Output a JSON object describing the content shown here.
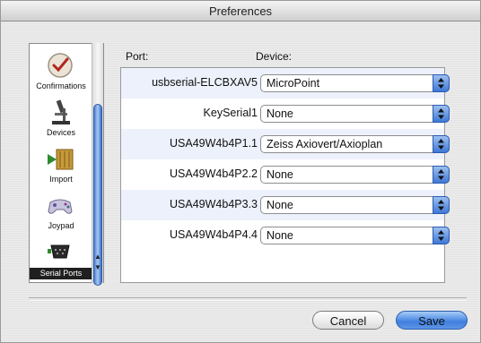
{
  "window": {
    "title": "Preferences"
  },
  "sidebar": {
    "items": [
      {
        "label": "Confirmations",
        "icon": "checkmark-icon",
        "selected": false
      },
      {
        "label": "Devices",
        "icon": "microscope-icon",
        "selected": false
      },
      {
        "label": "Import",
        "icon": "import-files-icon",
        "selected": false
      },
      {
        "label": "Joypad",
        "icon": "gamepad-icon",
        "selected": false
      },
      {
        "label": "Serial Ports",
        "icon": "serial-connector-icon",
        "selected": true
      }
    ]
  },
  "table": {
    "headers": {
      "port": "Port:",
      "device": "Device:"
    },
    "rows": [
      {
        "port": "usbserial-ELCBXAV5",
        "device": "MicroPoint"
      },
      {
        "port": "KeySerial1",
        "device": "None"
      },
      {
        "port": "USA49W4b4P1.1",
        "device": "Zeiss Axiovert/Axioplan"
      },
      {
        "port": "USA49W4b4P2.2",
        "device": "None"
      },
      {
        "port": "USA49W4b4P3.3",
        "device": "None"
      },
      {
        "port": "USA49W4b4P4.4",
        "device": "None"
      }
    ]
  },
  "buttons": {
    "cancel": "Cancel",
    "save": "Save"
  },
  "colors": {
    "accent": "#3f7fe0",
    "row_alt": "#ecf1fb",
    "selected_bg": "#1f1f1f"
  }
}
